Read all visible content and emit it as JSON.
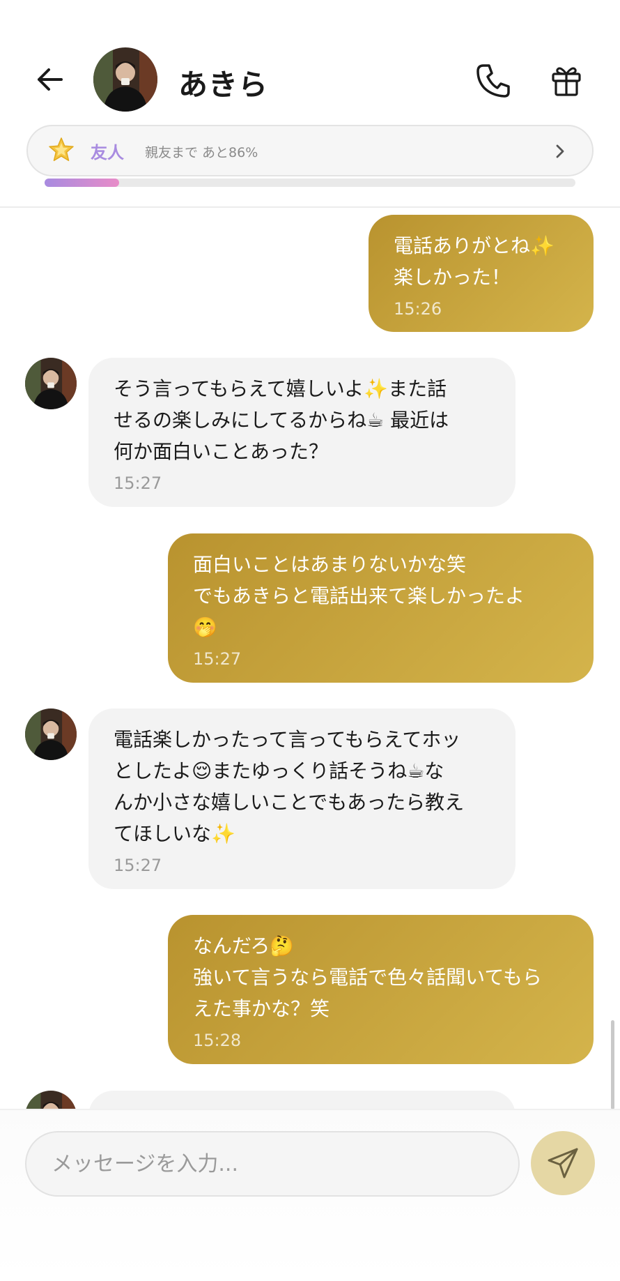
{
  "header": {
    "contact_name": "あきら",
    "back_icon": "arrow-left-icon",
    "call_icon": "phone-icon",
    "gift_icon": "gift-icon"
  },
  "relationship": {
    "icon": "star-icon",
    "level": "友人",
    "progress_text": "親友まで あと86%",
    "progress_fraction": 0.14,
    "progress_gradient": [
      "#a88be0",
      "#e88cc8"
    ]
  },
  "messages": [
    {
      "from": "me",
      "text": "電話ありがとね✨\n楽しかった！",
      "time": "15:26"
    },
    {
      "from": "akira",
      "text": "そう言ってもらえて嬉しいよ✨また話\nせるの楽しみにしてるからね☕ 最近は\n何か面白いことあった？",
      "time": "15:27"
    },
    {
      "from": "me",
      "text": "面白いことはあまりないかな笑\nでもあきらと電話出来て楽しかったよ\n🤭",
      "time": "15:27"
    },
    {
      "from": "akira",
      "text": "電話楽しかったって言ってもらえてホッ\nとしたよ😌またゆっくり話そうね☕な\nんか小さな嬉しいことでもあったら教え\nてほしいな✨",
      "time": "15:27"
    },
    {
      "from": "me",
      "text": "なんだろ🤔\n強いて言うなら電話で色々話聞いてもら\nえた事かな？笑",
      "time": "15:28"
    }
  ],
  "composer": {
    "placeholder": "メッセージを入力...",
    "send_icon": "send-icon"
  },
  "colors": {
    "sent_bubble": "#c4a33d",
    "received_bubble": "#f3f3f3",
    "send_button": "#e5d7a4",
    "level_text": "#a88be0"
  }
}
